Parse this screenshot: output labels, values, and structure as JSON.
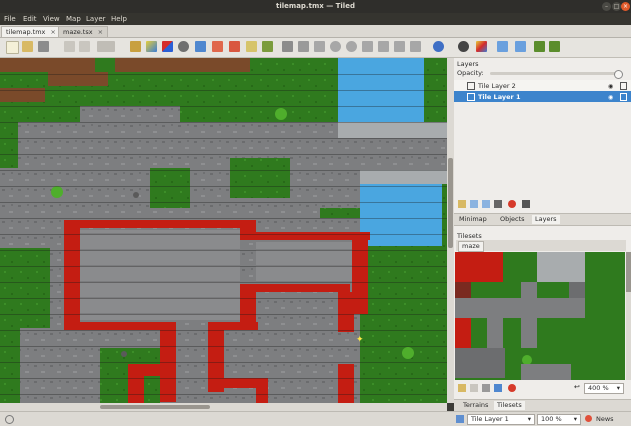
{
  "window": {
    "title": "tilemap.tmx — Tiled"
  },
  "menu": [
    "File",
    "Edit",
    "View",
    "Map",
    "Layer",
    "Help"
  ],
  "tabs": [
    {
      "label": "tilemap.tmx",
      "active": true
    },
    {
      "label": "maze.tsx",
      "active": false
    }
  ],
  "layers_panel": {
    "title": "Layers",
    "opacity_label": "Opacity:",
    "layers": [
      {
        "name": "Tile Layer 2",
        "selected": false
      },
      {
        "name": "Tile Layer 1",
        "selected": true
      }
    ],
    "tabs": [
      "Minimap",
      "Objects",
      "Layers"
    ],
    "active_tab": "Layers"
  },
  "tilesets_panel": {
    "title": "Tilesets",
    "tileset_tab": "maze",
    "zoom": "400 %",
    "tabs": [
      "Terrains",
      "Tilesets"
    ],
    "active_tab": "Tilesets"
  },
  "statusbar": {
    "layer_select": "Tile Layer 1",
    "zoom": "100 %",
    "news": "News"
  },
  "colors": {
    "grass": "#2f7a1e",
    "stone": "#7d7e80",
    "wall_red": "#c41d12",
    "water": "#4aa6e0",
    "dirt": "#7a4a2a",
    "selection": "#3d84cc"
  }
}
